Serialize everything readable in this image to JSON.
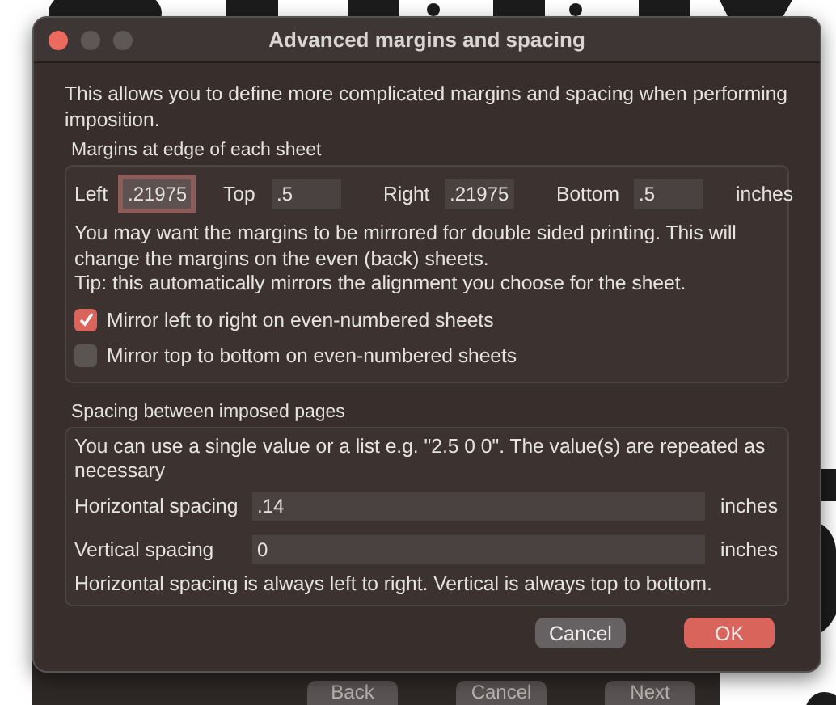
{
  "window": {
    "title": "Advanced margins and spacing"
  },
  "intro": "This allows you to define more complicated margins and spacing when performing imposition.",
  "margins": {
    "title": "Margins at edge of each sheet",
    "fields": [
      {
        "label": "Left",
        "value": ".21975",
        "focused": true
      },
      {
        "label": "Top",
        "value": ".5",
        "focused": false
      },
      {
        "label": "Right",
        "value": ".21975",
        "focused": false
      },
      {
        "label": "Bottom",
        "value": ".5",
        "focused": false
      }
    ],
    "unit": "inches",
    "note": "You may want the margins to be mirrored for double sided printing. This will change the margins on the even (back) sheets.",
    "tip": "Tip: this automatically mirrors the alignment you choose for the sheet.",
    "checkboxes": [
      {
        "label": "Mirror left to right on even-numbered sheets",
        "checked": true
      },
      {
        "label": "Mirror top to bottom on even-numbered sheets",
        "checked": false
      }
    ]
  },
  "spacing": {
    "title": "Spacing between imposed pages",
    "note": "You can use a single value or a list e.g. \"2.5 0 0\". The value(s) are repeated as necessary",
    "fields": [
      {
        "label": "Horizontal spacing",
        "value": ".14",
        "unit": "inches"
      },
      {
        "label": "Vertical spacing",
        "value": "0",
        "unit": "inches"
      }
    ],
    "footer": "Horizontal spacing is always left to right. Vertical is always top to bottom."
  },
  "buttons": [
    {
      "label": "Cancel",
      "kind": "secondary"
    },
    {
      "label": "OK",
      "kind": "primary"
    }
  ],
  "background_window": {
    "buttons": [
      "Back",
      "Cancel",
      "Next"
    ]
  }
}
